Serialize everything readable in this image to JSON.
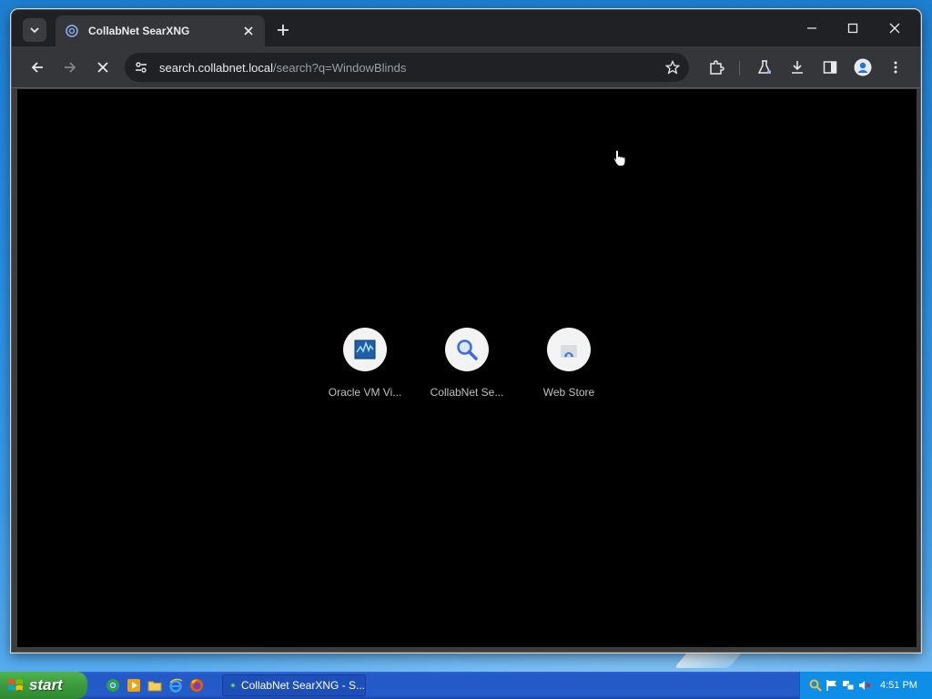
{
  "tab": {
    "title": "CollabNet SearXNG"
  },
  "address": {
    "host": "search.collabnet.local",
    "path": "/search?q=WindowBlinds"
  },
  "shortcuts": [
    {
      "label": "Oracle VM Vi..."
    },
    {
      "label": "CollabNet Se..."
    },
    {
      "label": "Web Store"
    }
  ],
  "taskbar": {
    "start_label": "start",
    "window_button_label": "CollabNet SearXNG - S...",
    "clock": "4:51 PM"
  }
}
